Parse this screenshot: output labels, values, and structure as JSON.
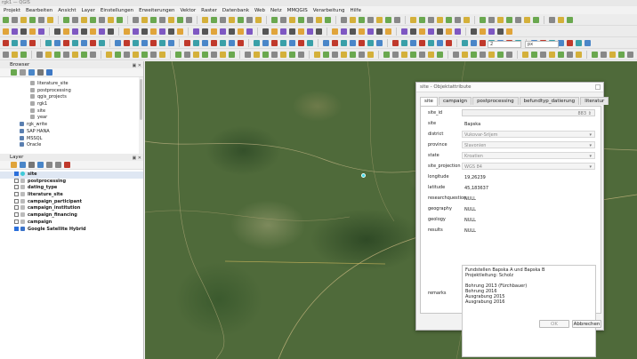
{
  "window_title": "rgk1 — QGIS",
  "menu": [
    "Projekt",
    "Bearbeiten",
    "Ansicht",
    "Layer",
    "Einstellungen",
    "Erweiterungen",
    "Vektor",
    "Raster",
    "Datenbank",
    "Web",
    "Netz",
    "MMQGIS",
    "Verarbeitung",
    "Hilfe"
  ],
  "toolbar": {
    "scale_value": "2",
    "unit_value": "px"
  },
  "browser": {
    "title": "Browser",
    "items": [
      {
        "label": "literature_site",
        "indent": 1
      },
      {
        "label": "postprocessing",
        "indent": 1
      },
      {
        "label": "qgis_projects",
        "indent": 1
      },
      {
        "label": "rgk1",
        "indent": 1
      },
      {
        "label": "site",
        "indent": 1
      },
      {
        "label": "year",
        "indent": 1
      },
      {
        "label": "rgk_write",
        "indent": 0
      },
      {
        "label": "SAP HANA",
        "indent": 0
      },
      {
        "label": "MSSQL",
        "indent": 0
      },
      {
        "label": "Oracle",
        "indent": 0
      }
    ]
  },
  "layers": {
    "title": "Layer",
    "items": [
      {
        "label": "site",
        "checked": true,
        "color": "#3fc9d8"
      },
      {
        "label": "postprocessing",
        "checked": false,
        "color": "#bbbbbb"
      },
      {
        "label": "dating_type",
        "checked": false,
        "color": "#bbbbbb"
      },
      {
        "label": "literature_site",
        "checked": false,
        "color": "#bbbbbb"
      },
      {
        "label": "campaign_participant",
        "checked": false,
        "color": "#bbbbbb"
      },
      {
        "label": "campaign_institution",
        "checked": false,
        "color": "#bbbbbb"
      },
      {
        "label": "campaign_financing",
        "checked": false,
        "color": "#bbbbbb"
      },
      {
        "label": "campaign",
        "checked": false,
        "color": "#bbbbbb"
      },
      {
        "label": "Google Satellite Hybrid",
        "checked": true,
        "color": "#3a72c8"
      }
    ]
  },
  "dialog": {
    "title": "site - Objektattribute",
    "tabs": [
      "site",
      "campaign",
      "postprocessing",
      "befundtyp_datierung",
      "literatur"
    ],
    "active_tab": "site",
    "fields": [
      {
        "label": "site_id",
        "value": "883",
        "kind": "num"
      },
      {
        "label": "site",
        "value": "Bapska",
        "kind": "text"
      },
      {
        "label": "district",
        "value": "Vukovar-Srijem",
        "kind": "combo"
      },
      {
        "label": "province",
        "value": "Slavonien",
        "kind": "combo"
      },
      {
        "label": "state",
        "value": "Kroatien",
        "kind": "combo"
      },
      {
        "label": "site_projection",
        "value": "WGS 84",
        "kind": "combo"
      },
      {
        "label": "longitude",
        "value": "19,26239",
        "kind": "text"
      },
      {
        "label": "latitude",
        "value": "45,183637",
        "kind": "text"
      },
      {
        "label": "researchquestion",
        "value": "NULL",
        "kind": "text"
      },
      {
        "label": "geography",
        "value": "NULL",
        "kind": "text"
      },
      {
        "label": "geology",
        "value": "NULL",
        "kind": "text"
      },
      {
        "label": "results",
        "value": "NULL",
        "kind": "text"
      }
    ],
    "remarks_label": "remarks",
    "remarks_lines": [
      "Fundstellen Bapska A und Bapska B",
      "Projektleitung: Scholz",
      "",
      "Bohrung 2013 (Fürchbauer)",
      "Bohrung 2016",
      "Ausgrabung 2015",
      "Ausgrabung 2016"
    ],
    "ok_label": "OK",
    "cancel_label": "Abbrechen"
  }
}
